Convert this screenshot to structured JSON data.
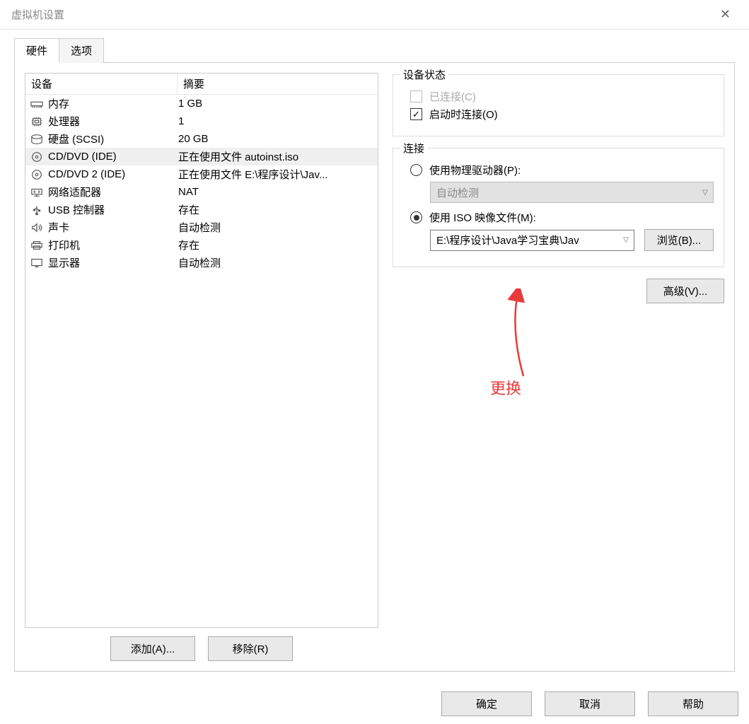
{
  "window": {
    "title": "虚拟机设置"
  },
  "tabs": {
    "hardware": "硬件",
    "options": "选项"
  },
  "device_table": {
    "col_device": "设备",
    "col_summary": "摘要"
  },
  "devices": [
    {
      "icon": "memory",
      "name": "内存",
      "summary": "1 GB"
    },
    {
      "icon": "cpu",
      "name": "处理器",
      "summary": "1"
    },
    {
      "icon": "disk",
      "name": "硬盘 (SCSI)",
      "summary": "20 GB"
    },
    {
      "icon": "cd",
      "name": "CD/DVD (IDE)",
      "summary": "正在使用文件 autoinst.iso",
      "selected": true
    },
    {
      "icon": "cd",
      "name": "CD/DVD 2 (IDE)",
      "summary": "正在使用文件 E:\\程序设计\\Jav..."
    },
    {
      "icon": "net",
      "name": "网络适配器",
      "summary": "NAT"
    },
    {
      "icon": "usb",
      "name": "USB 控制器",
      "summary": "存在"
    },
    {
      "icon": "sound",
      "name": "声卡",
      "summary": "自动检测"
    },
    {
      "icon": "printer",
      "name": "打印机",
      "summary": "存在"
    },
    {
      "icon": "display",
      "name": "显示器",
      "summary": "自动检测"
    }
  ],
  "buttons": {
    "add": "添加(A)...",
    "remove": "移除(R)",
    "browse": "浏览(B)...",
    "advanced": "高级(V)...",
    "ok": "确定",
    "cancel": "取消",
    "help": "帮助"
  },
  "right": {
    "device_status_legend": "设备状态",
    "connected": "已连接(C)",
    "connect_on_start": "启动时连接(O)",
    "connection_legend": "连接",
    "use_physical": "使用物理驱动器(P):",
    "physical_value": "自动检测",
    "use_iso": "使用 ISO 映像文件(M):",
    "iso_value": "E:\\程序设计\\Java学习宝典\\Jav"
  },
  "annotation": "更换"
}
